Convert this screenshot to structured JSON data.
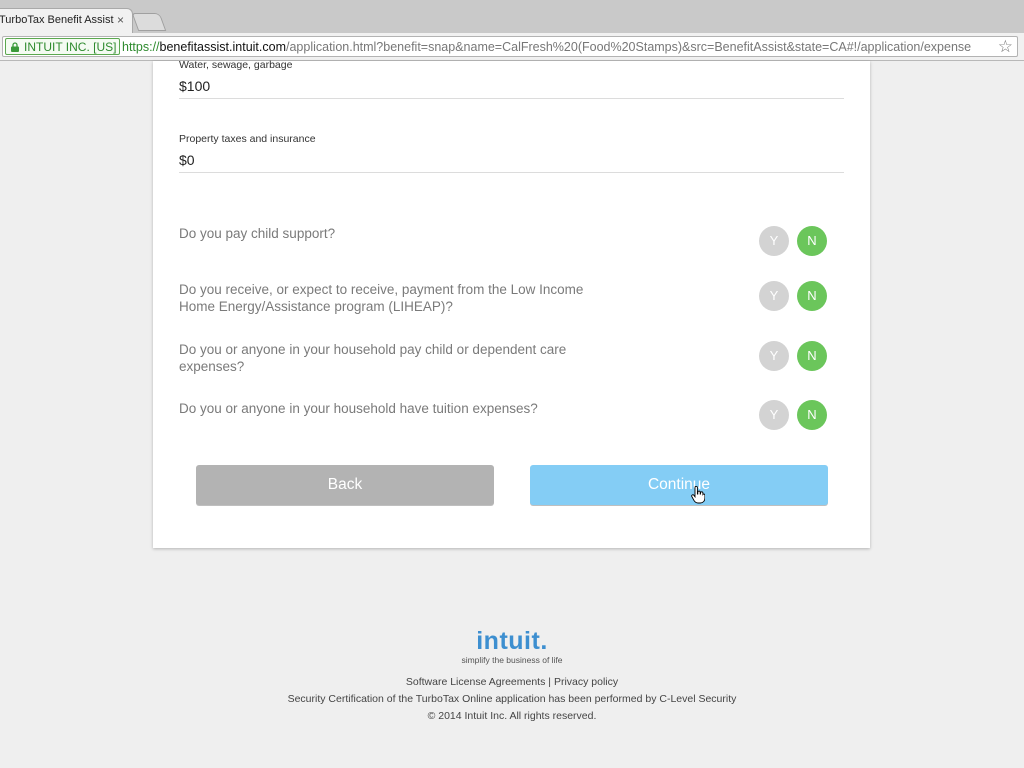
{
  "browser": {
    "tab_title": "TurboTax Benefit Assist",
    "tab_close": "×",
    "ev_label": "INTUIT INC. [US]",
    "url_scheme": "https://",
    "url_host": "benefitassist.intuit.com",
    "url_path": "/application.html?benefit=snap&name=CalFresh%20(Food%20Stamps)&src=BenefitAssist&state=CA#!/application/expense",
    "star_glyph": "☆"
  },
  "form": {
    "fields": [
      {
        "label": "Water, sewage, garbage",
        "value": "$100"
      },
      {
        "label": "Property taxes and insurance",
        "value": "$0"
      }
    ],
    "questions": [
      {
        "text": "Do you pay child support?",
        "yes": "Y",
        "no": "N",
        "selected": "N"
      },
      {
        "text": "Do you receive, or expect to receive, payment from the Low Income Home Energy/Assistance program (LIHEAP)?",
        "yes": "Y",
        "no": "N",
        "selected": "N"
      },
      {
        "text": "Do you or anyone in your household pay child or dependent care expenses?",
        "yes": "Y",
        "no": "N",
        "selected": "N"
      },
      {
        "text": "Do you or anyone in your household have tuition expenses?",
        "yes": "Y",
        "no": "N",
        "selected": "N"
      }
    ],
    "back_label": "Back",
    "continue_label": "Continue"
  },
  "footer": {
    "logo": "intuit.",
    "tagline": "simplify the business of life",
    "link_software": "Software License Agreements",
    "separator": "|",
    "link_privacy": "Privacy policy",
    "security_text": "Security Certification of the TurboTax Online application has been performed by C-Level Security",
    "copyright": "© 2014 Intuit Inc. All rights reserved."
  },
  "colors": {
    "yes_inactive": "#d3d3d3",
    "no_selected": "#6bc65b",
    "back_button": "#b3b3b3",
    "continue_button": "#84cdf5",
    "brand_blue": "#3d8fd0"
  }
}
